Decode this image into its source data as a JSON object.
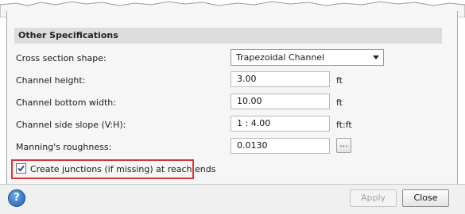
{
  "section": {
    "title": "Other Specifications"
  },
  "fields": {
    "cross_section": {
      "label": "Cross section shape:",
      "value": "Trapezoidal Channel"
    },
    "channel_height": {
      "label": "Channel height:",
      "value": "3.00",
      "unit": "ft"
    },
    "bottom_width": {
      "label": "Channel bottom width:",
      "value": "10.00",
      "unit": "ft"
    },
    "side_slope": {
      "label": "Channel side slope (V:H):",
      "value": "1 : 4.00",
      "unit": "ft:ft"
    },
    "roughness": {
      "label": "Manning's roughness:",
      "value": "0.0130",
      "button": "..."
    }
  },
  "create_junctions": {
    "label": "Create junctions (if missing) at reach ends",
    "checked": true
  },
  "buttons": {
    "help": "?",
    "apply": "Apply",
    "close": "Close"
  },
  "colors": {
    "highlight": "#d9343b",
    "help_blue": "#1e5fae"
  },
  "icons": {
    "dropdown": "chevron-down-icon",
    "checkbox": "checkmark-icon",
    "help": "help-icon"
  }
}
